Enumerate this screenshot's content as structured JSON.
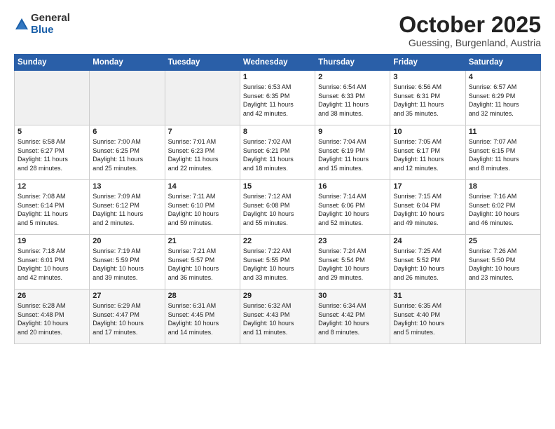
{
  "logo": {
    "general": "General",
    "blue": "Blue"
  },
  "header": {
    "month": "October 2025",
    "location": "Guessing, Burgenland, Austria"
  },
  "weekdays": [
    "Sunday",
    "Monday",
    "Tuesday",
    "Wednesday",
    "Thursday",
    "Friday",
    "Saturday"
  ],
  "weeks": [
    [
      {
        "day": "",
        "info": ""
      },
      {
        "day": "",
        "info": ""
      },
      {
        "day": "",
        "info": ""
      },
      {
        "day": "1",
        "info": "Sunrise: 6:53 AM\nSunset: 6:35 PM\nDaylight: 11 hours\nand 42 minutes."
      },
      {
        "day": "2",
        "info": "Sunrise: 6:54 AM\nSunset: 6:33 PM\nDaylight: 11 hours\nand 38 minutes."
      },
      {
        "day": "3",
        "info": "Sunrise: 6:56 AM\nSunset: 6:31 PM\nDaylight: 11 hours\nand 35 minutes."
      },
      {
        "day": "4",
        "info": "Sunrise: 6:57 AM\nSunset: 6:29 PM\nDaylight: 11 hours\nand 32 minutes."
      }
    ],
    [
      {
        "day": "5",
        "info": "Sunrise: 6:58 AM\nSunset: 6:27 PM\nDaylight: 11 hours\nand 28 minutes."
      },
      {
        "day": "6",
        "info": "Sunrise: 7:00 AM\nSunset: 6:25 PM\nDaylight: 11 hours\nand 25 minutes."
      },
      {
        "day": "7",
        "info": "Sunrise: 7:01 AM\nSunset: 6:23 PM\nDaylight: 11 hours\nand 22 minutes."
      },
      {
        "day": "8",
        "info": "Sunrise: 7:02 AM\nSunset: 6:21 PM\nDaylight: 11 hours\nand 18 minutes."
      },
      {
        "day": "9",
        "info": "Sunrise: 7:04 AM\nSunset: 6:19 PM\nDaylight: 11 hours\nand 15 minutes."
      },
      {
        "day": "10",
        "info": "Sunrise: 7:05 AM\nSunset: 6:17 PM\nDaylight: 11 hours\nand 12 minutes."
      },
      {
        "day": "11",
        "info": "Sunrise: 7:07 AM\nSunset: 6:15 PM\nDaylight: 11 hours\nand 8 minutes."
      }
    ],
    [
      {
        "day": "12",
        "info": "Sunrise: 7:08 AM\nSunset: 6:14 PM\nDaylight: 11 hours\nand 5 minutes."
      },
      {
        "day": "13",
        "info": "Sunrise: 7:09 AM\nSunset: 6:12 PM\nDaylight: 11 hours\nand 2 minutes."
      },
      {
        "day": "14",
        "info": "Sunrise: 7:11 AM\nSunset: 6:10 PM\nDaylight: 10 hours\nand 59 minutes."
      },
      {
        "day": "15",
        "info": "Sunrise: 7:12 AM\nSunset: 6:08 PM\nDaylight: 10 hours\nand 55 minutes."
      },
      {
        "day": "16",
        "info": "Sunrise: 7:14 AM\nSunset: 6:06 PM\nDaylight: 10 hours\nand 52 minutes."
      },
      {
        "day": "17",
        "info": "Sunrise: 7:15 AM\nSunset: 6:04 PM\nDaylight: 10 hours\nand 49 minutes."
      },
      {
        "day": "18",
        "info": "Sunrise: 7:16 AM\nSunset: 6:02 PM\nDaylight: 10 hours\nand 46 minutes."
      }
    ],
    [
      {
        "day": "19",
        "info": "Sunrise: 7:18 AM\nSunset: 6:01 PM\nDaylight: 10 hours\nand 42 minutes."
      },
      {
        "day": "20",
        "info": "Sunrise: 7:19 AM\nSunset: 5:59 PM\nDaylight: 10 hours\nand 39 minutes."
      },
      {
        "day": "21",
        "info": "Sunrise: 7:21 AM\nSunset: 5:57 PM\nDaylight: 10 hours\nand 36 minutes."
      },
      {
        "day": "22",
        "info": "Sunrise: 7:22 AM\nSunset: 5:55 PM\nDaylight: 10 hours\nand 33 minutes."
      },
      {
        "day": "23",
        "info": "Sunrise: 7:24 AM\nSunset: 5:54 PM\nDaylight: 10 hours\nand 29 minutes."
      },
      {
        "day": "24",
        "info": "Sunrise: 7:25 AM\nSunset: 5:52 PM\nDaylight: 10 hours\nand 26 minutes."
      },
      {
        "day": "25",
        "info": "Sunrise: 7:26 AM\nSunset: 5:50 PM\nDaylight: 10 hours\nand 23 minutes."
      }
    ],
    [
      {
        "day": "26",
        "info": "Sunrise: 6:28 AM\nSunset: 4:48 PM\nDaylight: 10 hours\nand 20 minutes."
      },
      {
        "day": "27",
        "info": "Sunrise: 6:29 AM\nSunset: 4:47 PM\nDaylight: 10 hours\nand 17 minutes."
      },
      {
        "day": "28",
        "info": "Sunrise: 6:31 AM\nSunset: 4:45 PM\nDaylight: 10 hours\nand 14 minutes."
      },
      {
        "day": "29",
        "info": "Sunrise: 6:32 AM\nSunset: 4:43 PM\nDaylight: 10 hours\nand 11 minutes."
      },
      {
        "day": "30",
        "info": "Sunrise: 6:34 AM\nSunset: 4:42 PM\nDaylight: 10 hours\nand 8 minutes."
      },
      {
        "day": "31",
        "info": "Sunrise: 6:35 AM\nSunset: 4:40 PM\nDaylight: 10 hours\nand 5 minutes."
      },
      {
        "day": "",
        "info": ""
      }
    ]
  ]
}
